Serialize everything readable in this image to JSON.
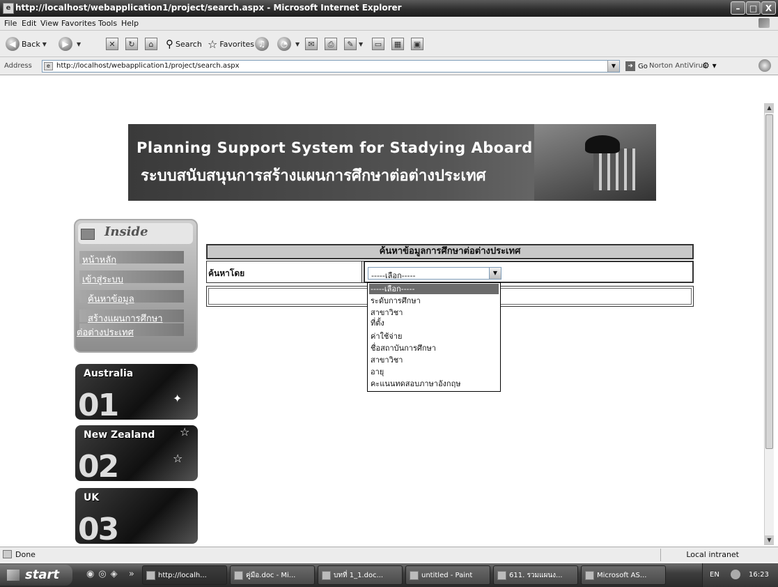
{
  "window": {
    "title": "http://localhost/webapplication1/project/search.aspx - Microsoft Internet Explorer",
    "minimize": "–",
    "maximize": "□",
    "close": "X"
  },
  "menu": [
    "File",
    "Edit",
    "View",
    "Favorites",
    "Tools",
    "Help"
  ],
  "toolbar": {
    "back": "Back",
    "search": "Search",
    "favorites": "Favorites"
  },
  "address": {
    "label": "Address",
    "url": "http://localhost/webapplication1/project/search.aspx",
    "go": "Go",
    "norton": "Norton AntiVirus"
  },
  "banner": {
    "title_en": "Planning Support System for Stadying Aboard",
    "title_th": "ระบบสนับสนุนการสร้างแผนการศึกษาต่อต่างประเทศ"
  },
  "sidebar": {
    "header": "Inside",
    "links": [
      "หน้าหลัก",
      "เข้าสู่ระบบ",
      "ค้นหาข้อมูล",
      "สร้างแผนการศึกษา",
      "ต่อต่างประเทศ"
    ]
  },
  "countries": [
    {
      "name": "Australia",
      "num": "01"
    },
    {
      "name": "New Zealand",
      "num": "02"
    },
    {
      "name": "UK",
      "num": "03"
    }
  ],
  "search": {
    "header": "ค้นหาข้อมูลการศึกษาต่อต่างประเทศ",
    "label": "ค้นหาโดย",
    "selected": "-----เลือก-----",
    "options": [
      "-----เลือก-----",
      "ระดับการศึกษา",
      "สาขาวิชา",
      "ที่ตั้ง",
      "ค่าใช้จ่าย",
      "ชื่อสถาบันการศึกษา",
      "สาขาวิชา",
      "อายุ",
      "คะแนนทดสอบภาษาอังกฤษ"
    ]
  },
  "status": {
    "left": "Done",
    "right": "Local intranet"
  },
  "taskbar": {
    "start": "start",
    "tasks": [
      "http://localh...",
      "คู่มือ.doc - Mi...",
      "บทที่ 1_1.doc...",
      "untitled - Paint",
      "611. รวมแผนง...",
      "Microsoft AS..."
    ],
    "lang": "EN",
    "clock": "16:23"
  }
}
